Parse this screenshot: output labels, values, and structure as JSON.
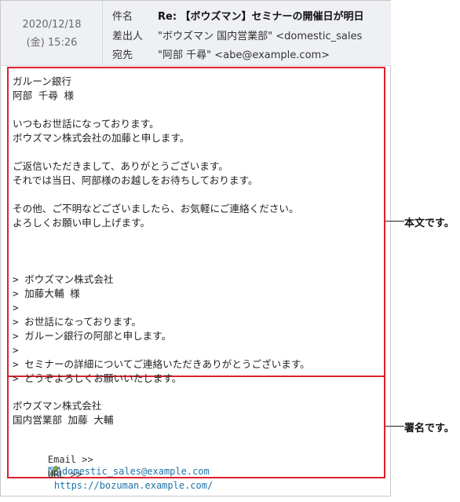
{
  "header": {
    "date": "2020/12/18",
    "time": "(金) 15:26",
    "subject_label": "件名",
    "subject": "Re: 【ボウズマン】セミナーの開催日が明日",
    "from_label": "差出人",
    "from": "\"ボウズマン 国内営業部\" <domestic_sales",
    "to_label": "宛先",
    "to": "\"阿部 千尋\" <abe@example.com>"
  },
  "body": {
    "lines": [
      "ガルーン銀行",
      "阿部 千尋 様",
      "",
      "いつもお世話になっております。",
      "ボウズマン株式会社の加藤と申します。",
      "",
      "ご返信いただきまして、ありがとうございます。",
      "それでは当日、阿部様のお越しをお待ちしております。",
      "",
      "その他、ご不明などございましたら、お気軽にご連絡ください。",
      "よろしくお願い申し上げます。",
      "",
      "",
      "",
      "> ボウズマン株式会社",
      "> 加藤大輔 様",
      ">",
      "> お世話になっております。",
      "> ガルーン銀行の阿部と申します。",
      ">",
      "> セミナーの詳細についてご連絡いただきありがとうございます。",
      "> どうぞよろしくお願いいたします。"
    ]
  },
  "signature": {
    "company": "ボウズマン株式会社",
    "dept_name": "国内営業部 加藤 大輔",
    "email_label": "Email >>",
    "email": "domestic_sales@example.com",
    "url_label": "URL >>",
    "url": "https://bozuman.example.com/"
  },
  "callouts": {
    "body": "本文です。",
    "signature": "署名です。"
  },
  "colors": {
    "highlight": "#e0202c",
    "link": "#1f73a8",
    "header_bg": "#eef0f3"
  }
}
